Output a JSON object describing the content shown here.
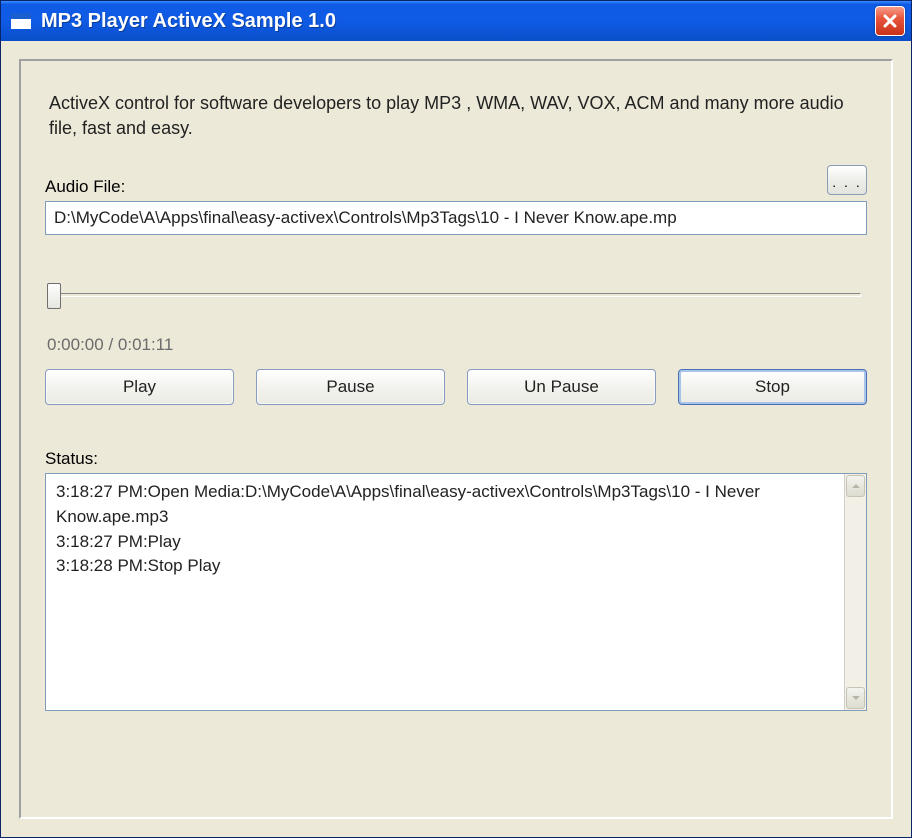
{
  "window": {
    "title": "MP3 Player ActiveX Sample 1.0"
  },
  "description": "ActiveX control for software developers to play MP3 , WMA, WAV, VOX, ACM and many more audio file, fast and easy.",
  "file": {
    "label": "Audio File:",
    "value": "D:\\MyCode\\A\\Apps\\final\\easy-activex\\Controls\\Mp3Tags\\10 - I Never Know.ape.mp",
    "browse_label": ". . ."
  },
  "time": "0:00:00 / 0:01:11",
  "buttons": {
    "play": "Play",
    "pause": "Pause",
    "unpause": "Un Pause",
    "stop": "Stop"
  },
  "status": {
    "label": "Status:",
    "lines": "3:18:27 PM:Open Media:D:\\MyCode\\A\\Apps\\final\\easy-activex\\Controls\\Mp3Tags\\10 - I Never Know.ape.mp3\n3:18:27 PM:Play\n3:18:28 PM:Stop Play"
  }
}
